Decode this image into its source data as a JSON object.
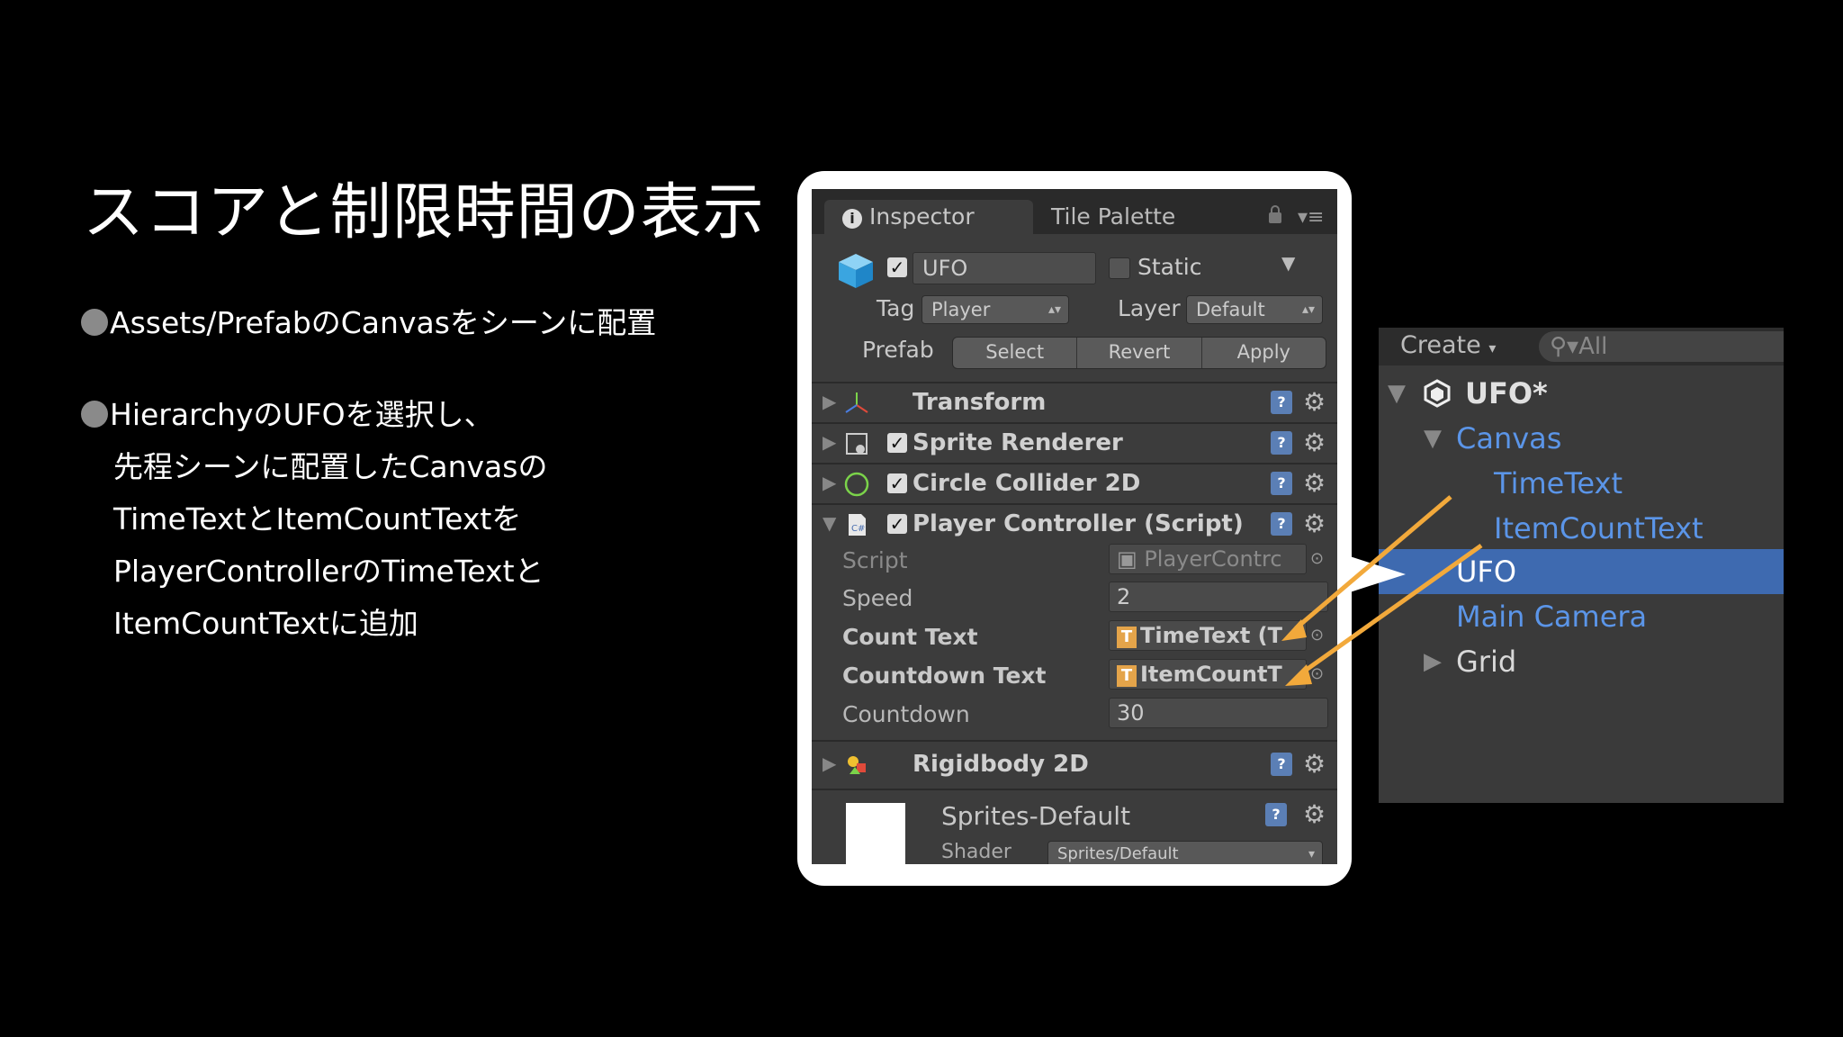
{
  "slide": {
    "title": "スコアと制限時間の表示",
    "bullets": [
      {
        "lines": [
          "Assets/PrefabのCanvasをシーンに配置"
        ]
      },
      {
        "lines": [
          "HierarchyのUFOを選択し、",
          "先程シーンに配置したCanvasの",
          "TimeTextとItemCountTextを",
          "PlayerControllerのTimeTextと",
          "ItemCountTextに追加"
        ]
      }
    ]
  },
  "inspector": {
    "tabs": [
      "Inspector",
      "Tile Palette"
    ],
    "object": {
      "name": "UFO",
      "static_label": "Static",
      "tag_label": "Tag",
      "tag_value": "Player",
      "layer_label": "Layer",
      "layer_value": "Default",
      "prefab_label": "Prefab",
      "prefab_buttons": [
        "Select",
        "Revert",
        "Apply"
      ]
    },
    "components": [
      {
        "name": "Transform"
      },
      {
        "name": "Sprite Renderer"
      },
      {
        "name": "Circle Collider 2D"
      },
      {
        "name": "Player Controller (Script)"
      },
      {
        "name": "Rigidbody 2D"
      }
    ],
    "properties": {
      "script_label": "Script",
      "script_value": "PlayerContrc",
      "speed_label": "Speed",
      "speed_value": "2",
      "count_text_label": "Count Text",
      "count_text_value": "TimeText (T",
      "countdown_text_label": "Countdown Text",
      "countdown_text_value": "ItemCountT",
      "countdown_label": "Countdown",
      "countdown_value": "30"
    },
    "material": {
      "name": "Sprites-Default",
      "shader_label": "Shader",
      "shader_value": "Sprites/Default"
    }
  },
  "hierarchy": {
    "create_label": "Create",
    "search_placeholder": "All",
    "items": [
      {
        "label": "UFO*"
      },
      {
        "label": "Canvas"
      },
      {
        "label": "TimeText"
      },
      {
        "label": "ItemCountText"
      },
      {
        "label": "UFO"
      },
      {
        "label": "Main Camera"
      },
      {
        "label": "Grid"
      }
    ]
  },
  "colors": {
    "accent_arrow": "#f2a93b",
    "selection": "#3e6ab0",
    "prefab_text": "#5b95e8"
  }
}
